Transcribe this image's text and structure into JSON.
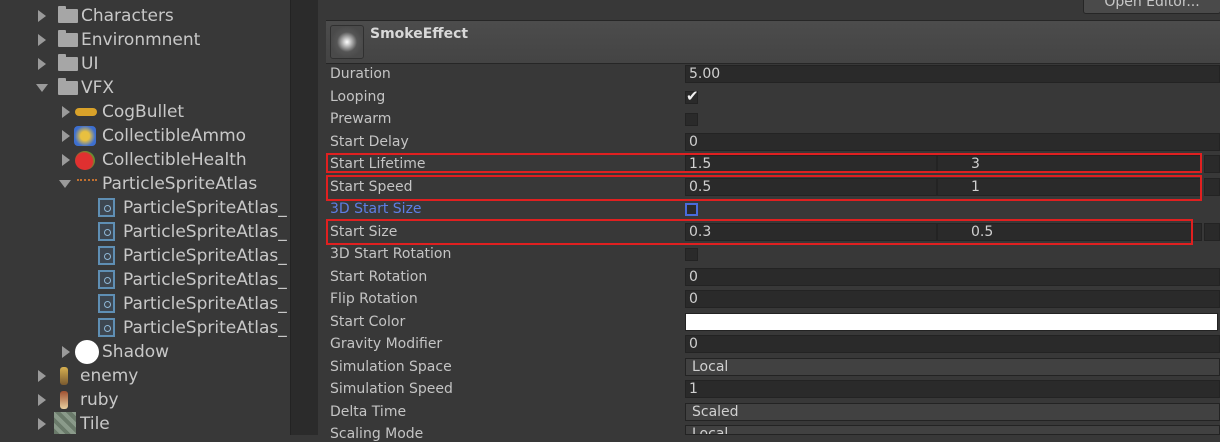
{
  "tree": {
    "folders": [
      {
        "label": "Characters",
        "icon": "folder-icon"
      },
      {
        "label": "Environmnent",
        "icon": "folder-icon"
      },
      {
        "label": "UI",
        "icon": "folder-icon"
      },
      {
        "label": "VFX",
        "icon": "folder-icon"
      }
    ],
    "vfx_children": [
      {
        "label": "CogBullet",
        "icon": "cog-bullet-icon"
      },
      {
        "label": "CollectibleAmmo",
        "icon": "ammo-icon"
      },
      {
        "label": "CollectibleHealth",
        "icon": "health-icon"
      },
      {
        "label": "ParticleSpriteAtlas",
        "icon": "sprite-atlas-icon"
      }
    ],
    "atlas_children": [
      "ParticleSpriteAtlas_",
      "ParticleSpriteAtlas_",
      "ParticleSpriteAtlas_",
      "ParticleSpriteAtlas_",
      "ParticleSpriteAtlas_",
      "ParticleSpriteAtlas_"
    ],
    "after": [
      {
        "label": "Shadow",
        "icon": "shadow-icon"
      },
      {
        "label": "enemy",
        "icon": "enemy-icon"
      },
      {
        "label": "ruby",
        "icon": "ruby-icon"
      },
      {
        "label": "Tile",
        "icon": "tile-icon"
      }
    ]
  },
  "inspector": {
    "open_editor_label": "Open Editor...",
    "module_title": "SmokeEffect",
    "properties": {
      "duration": {
        "label": "Duration",
        "value": "5.00"
      },
      "looping": {
        "label": "Looping",
        "checked": true
      },
      "prewarm": {
        "label": "Prewarm",
        "checked": false
      },
      "start_delay": {
        "label": "Start Delay",
        "value": "0"
      },
      "start_lifetime": {
        "label": "Start Lifetime",
        "min": "1.5",
        "max": "3"
      },
      "start_speed": {
        "label": "Start Speed",
        "min": "0.5",
        "max": "1"
      },
      "three_d_start_size": {
        "label": "3D Start Size",
        "checked": false
      },
      "start_size": {
        "label": "Start Size",
        "min": "0.3",
        "max": "0.5"
      },
      "three_d_start_rotation": {
        "label": "3D Start Rotation",
        "checked": false
      },
      "start_rotation": {
        "label": "Start Rotation",
        "value": "0"
      },
      "flip_rotation": {
        "label": "Flip Rotation",
        "value": "0"
      },
      "start_color": {
        "label": "Start Color",
        "color": "#ffffff"
      },
      "gravity_modifier": {
        "label": "Gravity Modifier",
        "value": "0"
      },
      "simulation_space": {
        "label": "Simulation Space",
        "value": "Local"
      },
      "simulation_speed": {
        "label": "Simulation Speed",
        "value": "1"
      },
      "delta_time": {
        "label": "Delta Time",
        "value": "Scaled"
      },
      "scaling_mode": {
        "label": "Scaling Mode",
        "value": "Local"
      }
    }
  },
  "colors": {
    "highlight": "#e02020",
    "accent_blue": "#5e7ee3"
  }
}
